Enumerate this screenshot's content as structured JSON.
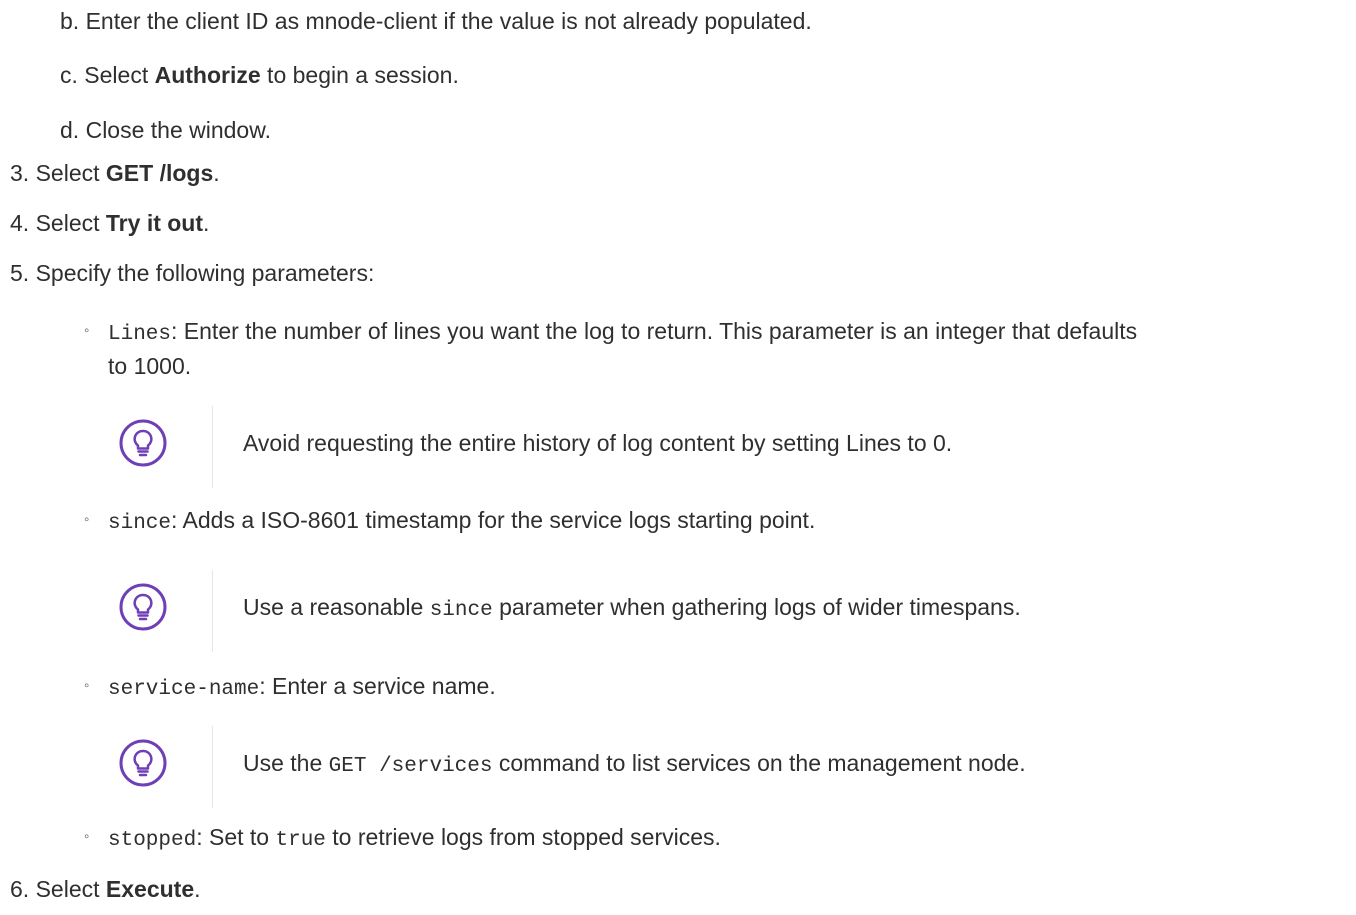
{
  "steps": {
    "b": {
      "marker": "b.",
      "text": "Enter the client ID as mnode-client if the value is not already populated."
    },
    "c": {
      "marker": "c.",
      "pre": "Select ",
      "bold": "Authorize",
      "post": " to begin a session."
    },
    "d": {
      "marker": "d.",
      "text": "Close the window."
    },
    "s3": {
      "marker": "3.",
      "pre": "Select ",
      "bold": "GET /logs",
      "post": "."
    },
    "s4": {
      "marker": "4.",
      "pre": "Select ",
      "bold": "Try it out",
      "post": "."
    },
    "s5": {
      "marker": "5.",
      "text": "Specify the following parameters:"
    },
    "s6": {
      "marker": "6.",
      "pre": "Select ",
      "bold": "Execute",
      "post": "."
    }
  },
  "params": {
    "lines": {
      "bullet": "◦",
      "code": "Lines",
      "text1": ": Enter the number of lines you want the log to return. This parameter is an integer that defaults",
      "text2": "to 1000.",
      "tip": "Avoid requesting the entire history of log content by setting Lines to 0."
    },
    "since": {
      "bullet": "◦",
      "code": "since",
      "text": ": Adds a ISO-8601 timestamp for the service logs starting point.",
      "tip_pre": "Use a reasonable ",
      "tip_code": "since",
      "tip_post": " parameter when gathering logs of wider timespans."
    },
    "service": {
      "bullet": "◦",
      "code": "service-name",
      "text": ": Enter a service name.",
      "tip_pre": "Use the ",
      "tip_code": "GET /services",
      "tip_post": " command to list services on the management node."
    },
    "stopped": {
      "bullet": "◦",
      "code": "stopped",
      "pre": ": Set to ",
      "code2": "true",
      "post": " to retrieve logs from stopped services."
    }
  },
  "icons": {
    "tip": "lightbulb-icon",
    "accent": "#6f3fb5"
  }
}
